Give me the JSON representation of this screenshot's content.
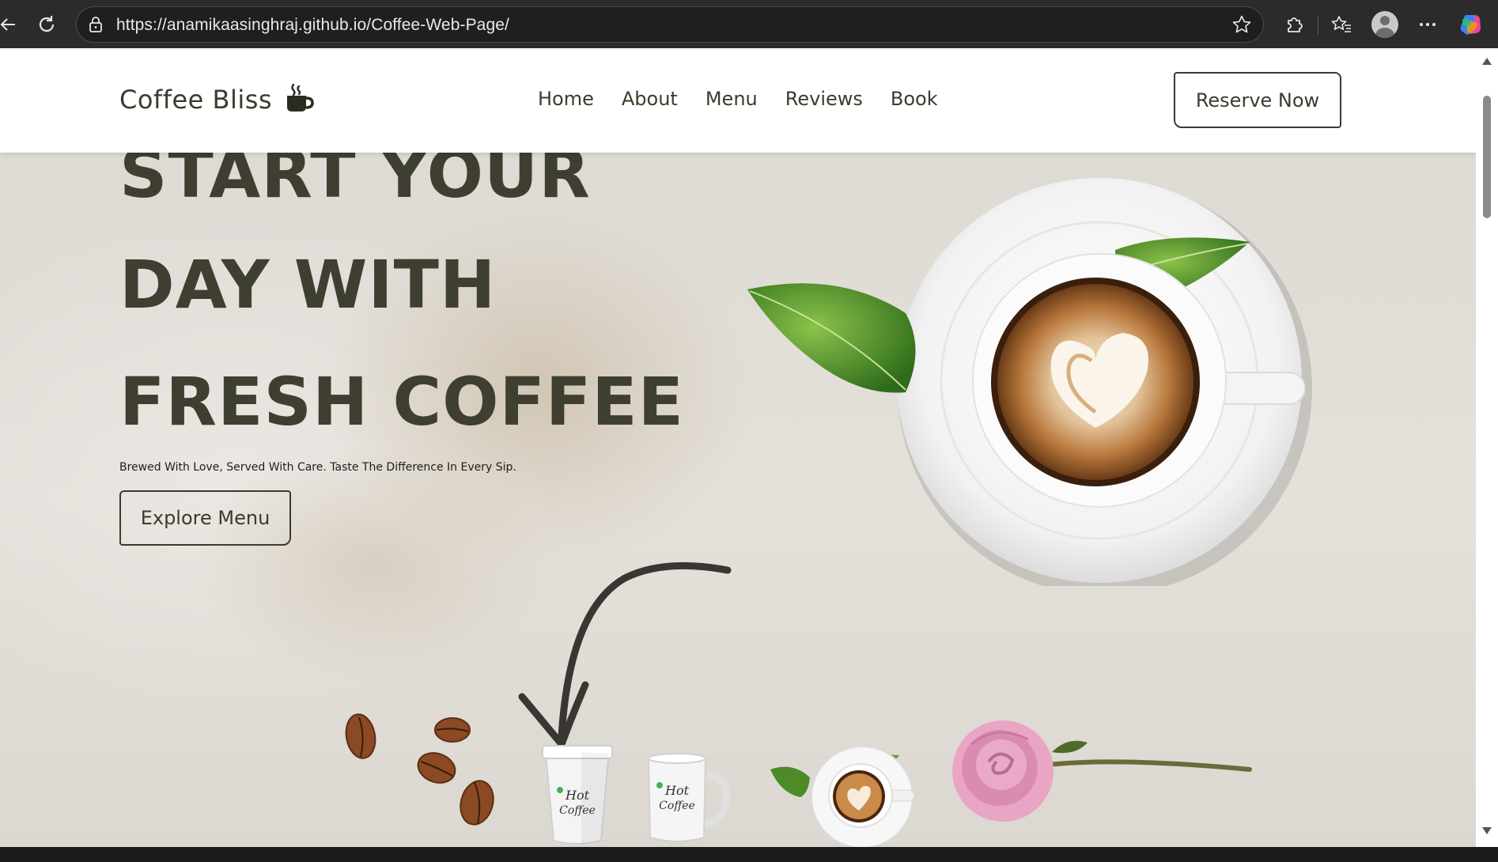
{
  "browser": {
    "url": "https://anamikaasinghraj.github.io/Coffee-Web-Page/",
    "icons": [
      "back-arrow-icon",
      "refresh-icon",
      "lock-icon",
      "star-icon",
      "extensions-icon",
      "favorites-icon",
      "profile-icon",
      "more-icon",
      "copilot-icon"
    ]
  },
  "nav": {
    "brand": "Coffee Bliss",
    "brand_icon": "mug-icon",
    "links": [
      "Home",
      "About",
      "Menu",
      "Reviews",
      "Book"
    ],
    "cta": "Reserve Now"
  },
  "hero": {
    "lines": [
      "START YOUR",
      "DAY WITH",
      "FRESH COFFEE"
    ],
    "tagline": "Brewed With Love, Served With Care. Taste The Difference In Every Sip.",
    "button": "Explore Menu",
    "cup_logo": "Hot Coffee",
    "images": [
      "coffee-cup-latte-art",
      "green-leaves",
      "coffee-beans",
      "paper-cup",
      "mug",
      "small-coffee-cup",
      "pink-rose",
      "curved-arrow"
    ]
  },
  "colors": {
    "text_dark": "#3f3f31",
    "nav_bg": "#ffffff",
    "hero_bg": "#e2ded7"
  }
}
